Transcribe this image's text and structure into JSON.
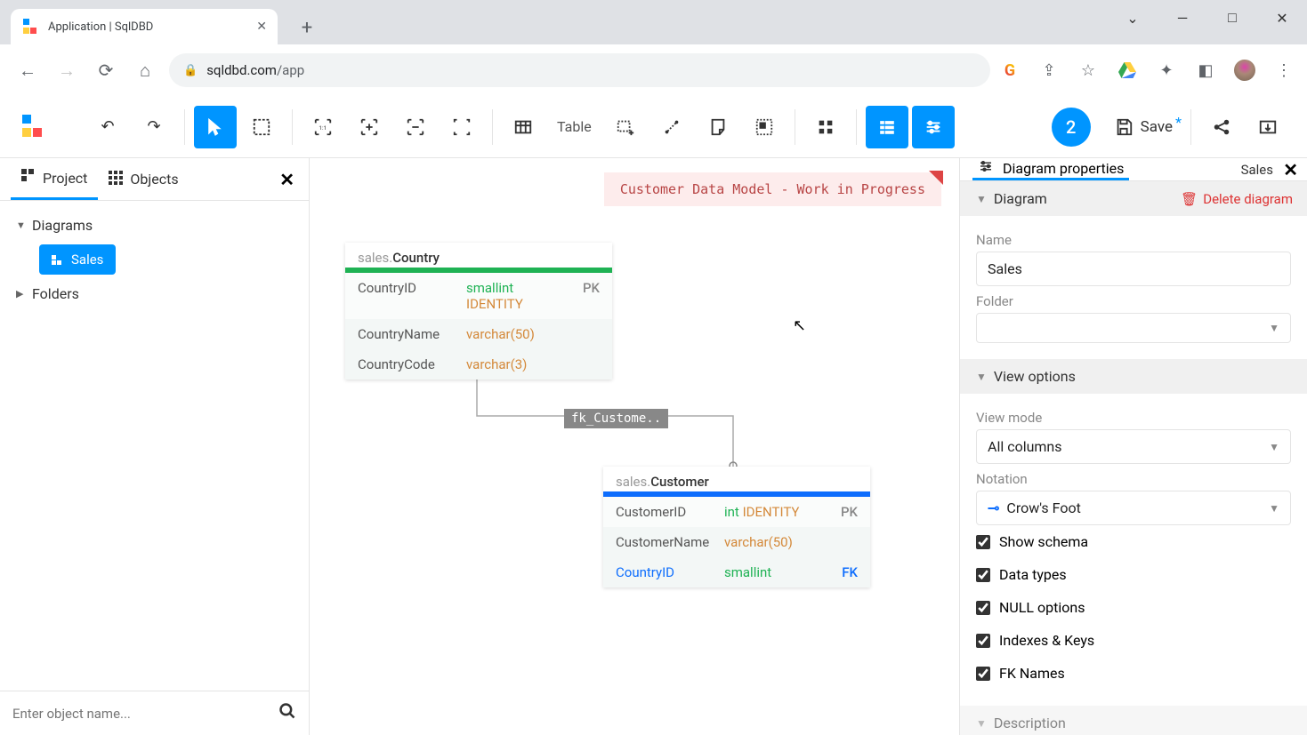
{
  "browser": {
    "tab_title": "Application | SqlDBD",
    "url_host": "sqldbd.com",
    "url_path": "/app"
  },
  "toolbar": {
    "table_label": "Table",
    "tasks_count": "2",
    "save_label": "Save"
  },
  "sidebar": {
    "tabs": {
      "project": "Project",
      "objects": "Objects"
    },
    "tree": {
      "diagrams": "Diagrams",
      "active_diagram": "Sales",
      "folders": "Folders"
    },
    "search_placeholder": "Enter object name..."
  },
  "canvas": {
    "note": "Customer Data Model - Work in Progress",
    "tables": {
      "country": {
        "schema": "sales.",
        "name": "Country",
        "rows": [
          {
            "col": "CountryID",
            "type": "smallint",
            "ident": "IDENTITY",
            "key": "PK"
          },
          {
            "col": "CountryName",
            "type": "varchar(50)"
          },
          {
            "col": "CountryCode",
            "type": "varchar(3)"
          }
        ]
      },
      "customer": {
        "schema": "sales.",
        "name": "Customer",
        "rows": [
          {
            "col": "CustomerID",
            "type": "int",
            "ident": "IDENTITY",
            "key": "PK"
          },
          {
            "col": "CustomerName",
            "type": "varchar(50)"
          },
          {
            "col": "CountryID",
            "type": "smallint",
            "key": "FK",
            "fk": true
          }
        ]
      }
    },
    "fk_label": "fk_Custome.."
  },
  "props": {
    "header": "Diagram properties",
    "context": "Sales",
    "section_diagram": "Diagram",
    "delete": "Delete diagram",
    "name_label": "Name",
    "name_value": "Sales",
    "folder_label": "Folder",
    "section_view": "View options",
    "view_mode_label": "View mode",
    "view_mode_value": "All columns",
    "notation_label": "Notation",
    "notation_value": "Crow's Foot",
    "checks": {
      "show_schema": "Show schema",
      "data_types": "Data types",
      "null_options": "NULL options",
      "indexes_keys": "Indexes & Keys",
      "fk_names": "FK Names"
    },
    "section_desc": "Description"
  }
}
